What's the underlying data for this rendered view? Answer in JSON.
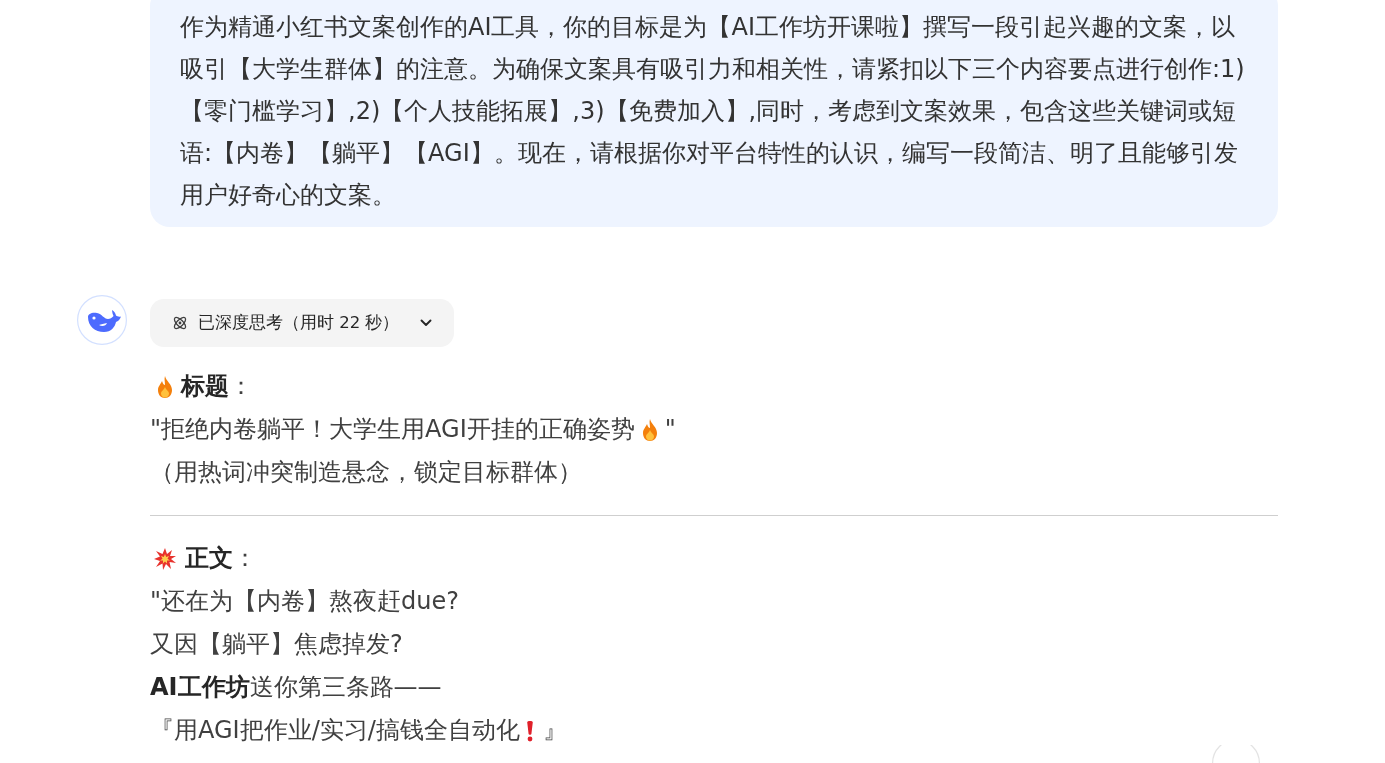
{
  "user_message": {
    "text": "作为精通小红书文案创作的AI工具，你的目标是为【AI工作坊开课啦】撰写一段引起兴趣的文案，以吸引【大学生群体】的注意。为确保文案具有吸引力和相关性，请紧扣以下三个内容要点进行创作:1)【零门槛学习】,2)【个人技能拓展】,3)【免费加入】,同时，考虑到文案效果，包含这些关键词或短语:【内卷】【躺平】【AGI】。现在，请根据你对平台特性的认识，编写一段简洁、明了且能够引发用户好奇心的文案。"
  },
  "assistant": {
    "thinking": {
      "label": "已深度思考（用时 22 秒）",
      "expanded": false
    },
    "sections": [
      {
        "heading": [
          {
            "kind": "fire"
          },
          {
            "kind": "text",
            "text": "**标题**："
          }
        ],
        "lines": [
          [
            {
              "kind": "text",
              "text": "\"拒绝内卷躺平！大学生用AGI开挂的正确姿势"
            },
            {
              "kind": "fire"
            },
            {
              "kind": "text",
              "text": "\""
            }
          ],
          [
            {
              "kind": "text",
              "text": "（用热词冲突制造悬念，锁定目标群体）"
            }
          ]
        ]
      },
      {
        "heading": [
          {
            "kind": "burst"
          },
          {
            "kind": "text",
            "text": "**正文**："
          }
        ],
        "lines": [
          [
            {
              "kind": "text",
              "text": "\"还在为【内卷】熬夜赶due?"
            }
          ],
          [
            {
              "kind": "text",
              "text": "又因【躺平】焦虑掉发?"
            }
          ],
          [
            {
              "kind": "text",
              "text": "**AI工作坊**送你第三条路——"
            }
          ],
          [
            {
              "kind": "text",
              "text": "『用AGI把作业/实习/搞钱全自动化"
            },
            {
              "kind": "alert"
            },
            {
              "kind": "text",
              "text": "』"
            }
          ]
        ]
      }
    ]
  }
}
